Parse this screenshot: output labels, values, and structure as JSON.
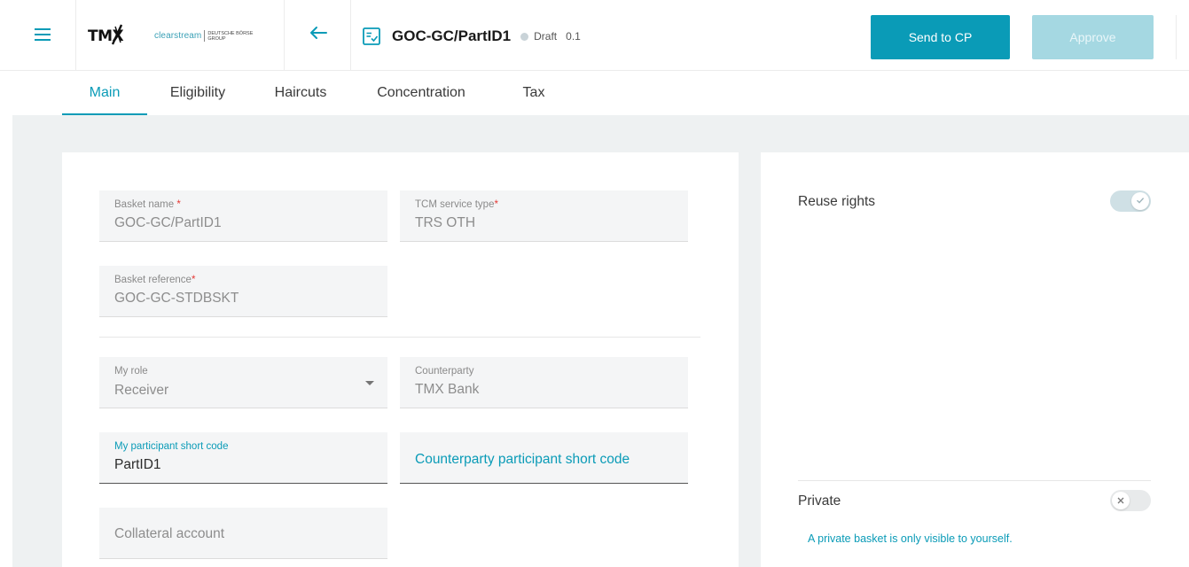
{
  "header": {
    "logo_tmx": "TMX",
    "logo_clearstream": "clearstream",
    "logo_db_line1": "Deutsche Börse",
    "logo_db_line2": "Group",
    "title": "GOC-GC/PartID1",
    "status": "Draft",
    "version": "0.1",
    "send_label": "Send to CP",
    "approve_label": "Approve"
  },
  "tabs": [
    {
      "label": "Main",
      "active": true
    },
    {
      "label": "Eligibility",
      "active": false
    },
    {
      "label": "Haircuts",
      "active": false
    },
    {
      "label": "Concentration",
      "active": false
    },
    {
      "label": "Tax",
      "active": false
    }
  ],
  "form": {
    "basket_name": {
      "label": "Basket name",
      "required": "*",
      "value": "GOC-GC/PartID1"
    },
    "tcm_service_type": {
      "label": "TCM service type",
      "required": "*",
      "value": "TRS OTH"
    },
    "basket_reference": {
      "label": "Basket reference",
      "required": "*",
      "value": "GOC-GC-STDBSKT"
    },
    "my_role": {
      "label": "My role",
      "value": "Receiver"
    },
    "counterparty": {
      "label": "Counterparty",
      "value": "TMX Bank"
    },
    "my_participant_short_code": {
      "label": "My participant short code",
      "value": "PartID1"
    },
    "counterparty_participant_short_code": {
      "placeholder": "Counterparty participant short code"
    },
    "collateral_account": {
      "placeholder": "Collateral account"
    }
  },
  "settings": {
    "reuse_rights": {
      "label": "Reuse rights",
      "enabled": true
    },
    "private": {
      "label": "Private",
      "enabled": false,
      "hint": "A private basket is only visible to yourself."
    }
  },
  "colors": {
    "accent": "#0a9bb7",
    "accent_disabled": "#a5d8e2",
    "required": "#e53935",
    "content_background": "#eef1f2"
  },
  "icons": {
    "menu": "hamburger-icon",
    "back": "arrow-left-icon",
    "document": "checklist-document-icon",
    "dropdown": "caret-down-icon",
    "toggle_on": "check-icon",
    "toggle_off": "close-icon"
  }
}
